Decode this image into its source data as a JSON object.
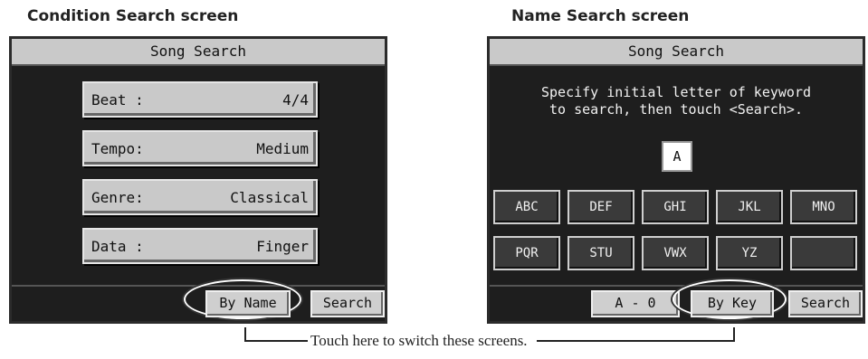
{
  "condition": {
    "caption": "Condition Search screen",
    "title": "Song Search",
    "fields": [
      {
        "label": "Beat :",
        "value": "4/4"
      },
      {
        "label": "Tempo:",
        "value": "Medium"
      },
      {
        "label": "Genre:",
        "value": "Classical"
      },
      {
        "label": "Data :",
        "value": "Finger"
      }
    ],
    "by_name_label": "By Name",
    "search_label": "Search"
  },
  "name": {
    "caption": "Name Search screen",
    "title": "Song Search",
    "instruction_line1": "Specify initial letter of keyword",
    "instruction_line2": "to search, then touch <Search>.",
    "selected_letter": "A",
    "keys": [
      "ABC",
      "DEF",
      "GHI",
      "JKL",
      "MNO",
      "PQR",
      "STU",
      "VWX",
      "YZ",
      ""
    ],
    "range_label": "A - 0",
    "by_key_label": "By Key",
    "search_label": "Search"
  },
  "callout": "Touch here to switch these screens."
}
